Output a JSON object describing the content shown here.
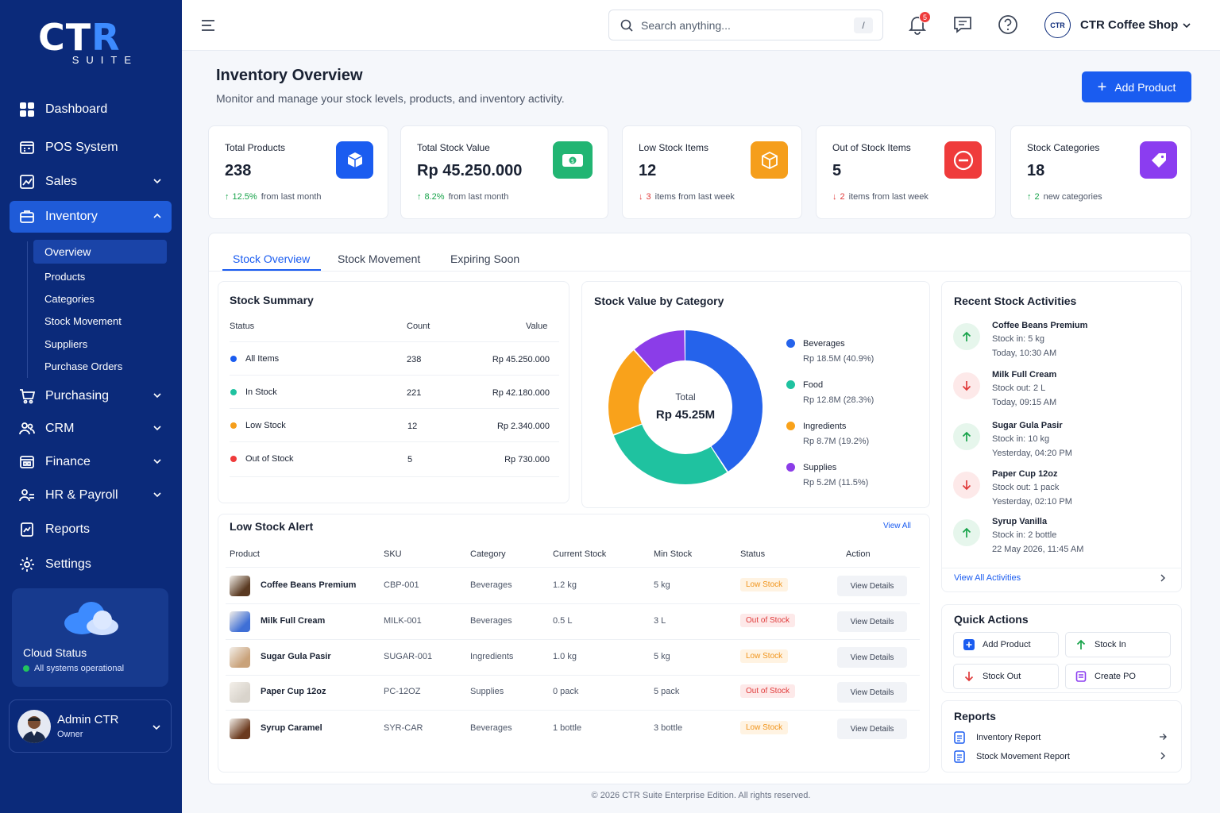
{
  "brand": {
    "logo_main": "CT",
    "logo_accent": "R",
    "logo_sub": "SUITE"
  },
  "sidebar": {
    "items": [
      {
        "label": "Dashboard",
        "icon": "grid-icon"
      },
      {
        "label": "POS System",
        "icon": "register-icon"
      },
      {
        "label": "Sales",
        "icon": "sales-icon"
      },
      {
        "label": "Inventory",
        "icon": "inventory-icon"
      },
      {
        "label": "Purchasing",
        "icon": "cart-icon"
      },
      {
        "label": "CRM",
        "icon": "users-icon"
      },
      {
        "label": "Finance",
        "icon": "finance-icon"
      },
      {
        "label": "HR & Payroll",
        "icon": "hr-icon"
      },
      {
        "label": "Reports",
        "icon": "reports-icon"
      },
      {
        "label": "Settings",
        "icon": "gear-icon"
      }
    ],
    "inventory_sub": [
      "Overview",
      "Products",
      "Categories",
      "Stock Movement",
      "Suppliers",
      "Purchase Orders"
    ],
    "cloud": {
      "title": "Cloud Status",
      "status": "All systems operational"
    },
    "admin": {
      "name": "Admin CTR",
      "role": "Owner"
    }
  },
  "topbar": {
    "search_placeholder": "Search anything...",
    "search_key": "/",
    "notif_count": "5",
    "shop_logo": "CTR",
    "shop_name": "CTR Coffee Shop"
  },
  "header": {
    "title": "Inventory Overview",
    "subtitle": "Monitor and manage your stock levels, products, and inventory activity.",
    "add_label": "Add Product"
  },
  "stats": [
    {
      "label": "Total Products",
      "value": "238",
      "change": "12.5%",
      "change_text": "from last month",
      "dir": "up",
      "color": "#1a5cf0",
      "icon": "box-icon"
    },
    {
      "label": "Total Stock Value",
      "value": "Rp 45.250.000",
      "change": "8.2%",
      "change_text": "from last month",
      "dir": "up",
      "color": "#22b573",
      "icon": "money-icon"
    },
    {
      "label": "Low Stock Items",
      "value": "12",
      "change": "3",
      "change_text": "items from last week",
      "dir": "down",
      "color": "#f59e1b",
      "icon": "package-icon"
    },
    {
      "label": "Out of Stock Items",
      "value": "5",
      "change": "2",
      "change_text": "items from last week",
      "dir": "down",
      "color": "#ef3b3b",
      "icon": "minus-circle-icon"
    },
    {
      "label": "Stock Categories",
      "value": "18",
      "change": "2",
      "change_text": "new categories",
      "dir": "up",
      "color": "#8b3df0",
      "icon": "tag-icon"
    }
  ],
  "tabs": [
    "Stock Overview",
    "Stock Movement",
    "Expiring Soon"
  ],
  "summary": {
    "title": "Stock Summary",
    "headers": [
      "Status",
      "Count",
      "Value"
    ],
    "rows": [
      {
        "status": "All Items",
        "count": "238",
        "value": "Rp 45.250.000",
        "color": "#1a5cf0"
      },
      {
        "status": "In Stock",
        "count": "221",
        "value": "Rp 42.180.000",
        "color": "#1fc2a0"
      },
      {
        "status": "Low Stock",
        "count": "12",
        "value": "Rp 2.340.000",
        "color": "#f59e1b"
      },
      {
        "status": "Out of Stock",
        "count": "5",
        "value": "Rp 730.000",
        "color": "#ef3b3b"
      }
    ]
  },
  "chart_data": {
    "type": "pie",
    "title": "Stock Value by Category",
    "center_label": "Total",
    "center_value": "Rp 45.25M",
    "categories": [
      "Beverages",
      "Food",
      "Ingredients",
      "Supplies"
    ],
    "values": [
      40.9,
      28.3,
      19.2,
      11.5
    ],
    "value_labels": [
      "Rp 18.5M (40.9%)",
      "Rp 12.8M (28.3%)",
      "Rp 8.7M (19.2%)",
      "Rp 5.2M (11.5%)"
    ],
    "colors": [
      "#2563eb",
      "#1fc2a0",
      "#f9a21b",
      "#8b3de8"
    ],
    "legend": "right"
  },
  "activities": {
    "title": "Recent Stock Activities",
    "items": [
      {
        "name": "Coffee Beans Premium",
        "detail": "Stock in: 5 kg",
        "time": "Today, 10:30 AM",
        "dir": "in"
      },
      {
        "name": "Milk Full Cream",
        "detail": "Stock out: 2 L",
        "time": "Today, 09:15 AM",
        "dir": "out"
      },
      {
        "name": "Sugar Gula Pasir",
        "detail": "Stock in: 10 kg",
        "time": "Yesterday, 04:20 PM",
        "dir": "in"
      },
      {
        "name": "Paper Cup 12oz",
        "detail": "Stock out: 1 pack",
        "time": "Yesterday, 02:10 PM",
        "dir": "out"
      },
      {
        "name": "Syrup Vanilla",
        "detail": "Stock in: 2 bottle",
        "time": "22 May 2026, 11:45 AM",
        "dir": "in"
      }
    ],
    "view_all": "View All Activities"
  },
  "low_stock": {
    "title": "Low Stock Alert",
    "view_all": "View All",
    "headers": [
      "Product",
      "SKU",
      "Category",
      "Current Stock",
      "Min Stock",
      "Status",
      "Action"
    ],
    "rows": [
      {
        "product": "Coffee Beans Premium",
        "sku": "CBP-001",
        "category": "Beverages",
        "current": "1.2 kg",
        "min": "5 kg",
        "status": "Low Stock",
        "kind": "low",
        "action": "View Details",
        "img": "#5a3a22"
      },
      {
        "product": "Milk Full Cream",
        "sku": "MILK-001",
        "category": "Beverages",
        "current": "0.5 L",
        "min": "3 L",
        "status": "Out of Stock",
        "kind": "out",
        "action": "View Details",
        "img": "#3f6fd6"
      },
      {
        "product": "Sugar Gula Pasir",
        "sku": "SUGAR-001",
        "category": "Ingredients",
        "current": "1.0 kg",
        "min": "5 kg",
        "status": "Low Stock",
        "kind": "low",
        "action": "View Details",
        "img": "#c9a27a"
      },
      {
        "product": "Paper Cup 12oz",
        "sku": "PC-12OZ",
        "category": "Supplies",
        "current": "0 pack",
        "min": "5 pack",
        "status": "Out of Stock",
        "kind": "out",
        "action": "View Details",
        "img": "#d9d4cc"
      },
      {
        "product": "Syrup Caramel",
        "sku": "SYR-CAR",
        "category": "Beverages",
        "current": "1 bottle",
        "min": "3 bottle",
        "status": "Low Stock",
        "kind": "low",
        "action": "View Details",
        "img": "#6b3a1e"
      }
    ]
  },
  "quick_actions": {
    "title": "Quick Actions",
    "items": [
      "Add Product",
      "Stock In",
      "Stock Out",
      "Create PO"
    ]
  },
  "reports": {
    "title": "Reports",
    "items": [
      "Inventory Report",
      "Stock Movement Report"
    ]
  },
  "footer": "© 2026 CTR Suite Enterprise Edition. All rights reserved."
}
